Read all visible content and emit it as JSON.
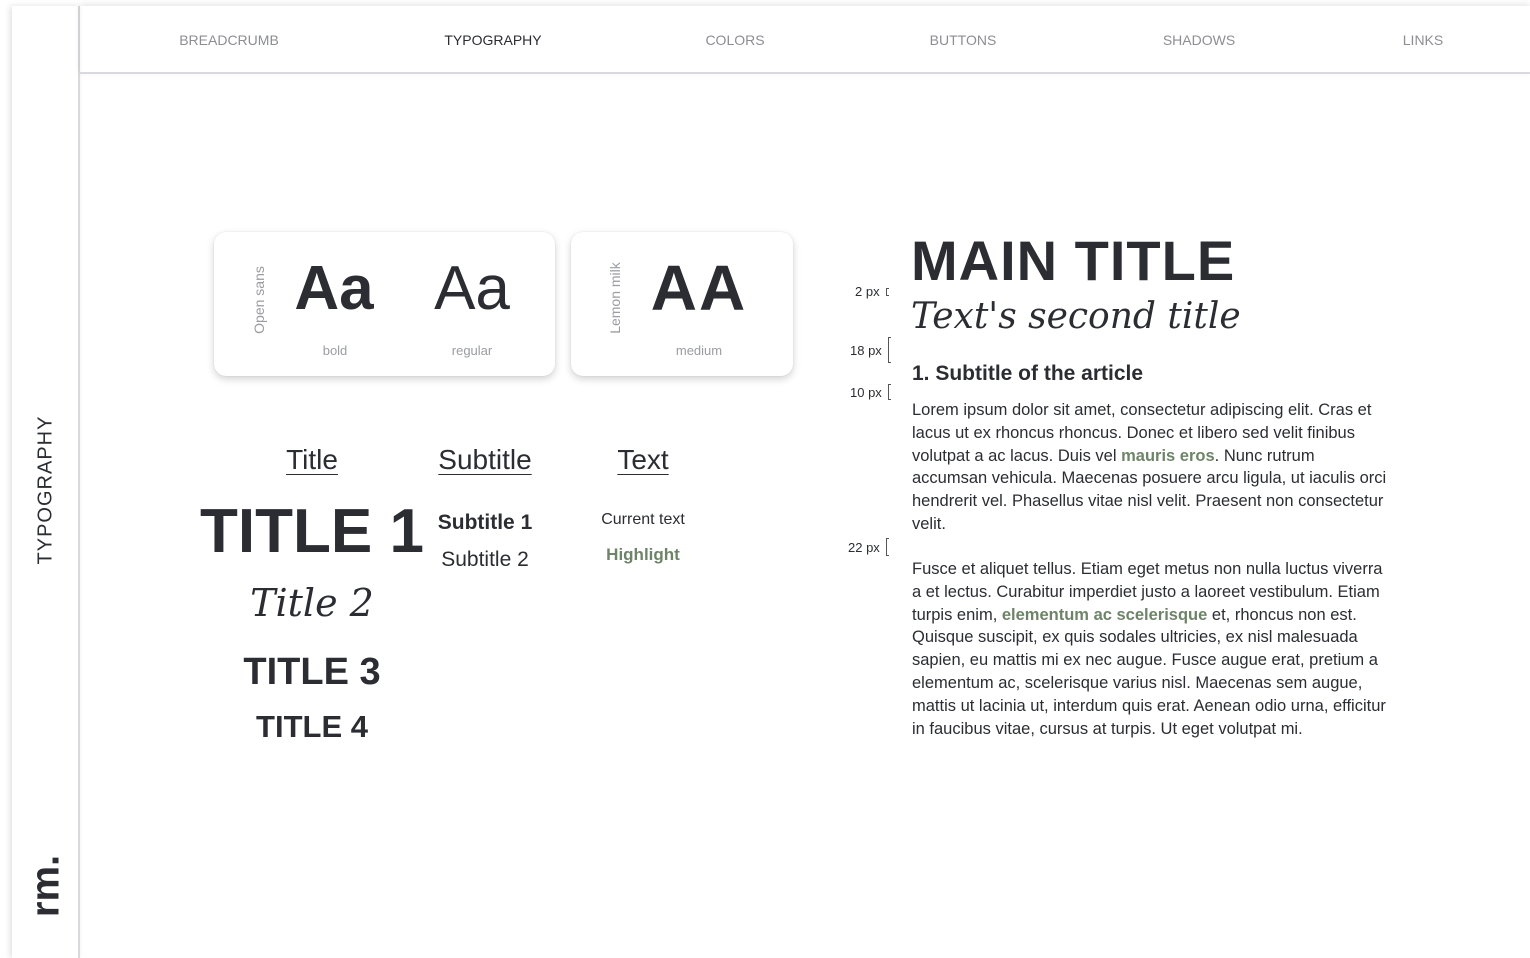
{
  "rail": {
    "label": "TYPOGRAPHY",
    "logo": "rm."
  },
  "nav": {
    "items": [
      {
        "label": "BREADCRUMB"
      },
      {
        "label": "TYPOGRAPHY"
      },
      {
        "label": "COLORS"
      },
      {
        "label": "BUTTONS"
      },
      {
        "label": "SHADOWS"
      },
      {
        "label": "LINKS"
      }
    ],
    "active": "TYPOGRAPHY"
  },
  "fonts": {
    "open_sans": {
      "name": "Open sans",
      "bold_sample": "Aa",
      "bold_label": "bold",
      "regular_sample": "Aa",
      "regular_label": "regular"
    },
    "lemon_milk": {
      "name": "Lemon milk",
      "sample": "AA",
      "label": "medium"
    }
  },
  "columns": {
    "title": {
      "header": "Title",
      "items": [
        "TITLE 1",
        "Title 2",
        "TITLE 3",
        "TITLE 4"
      ]
    },
    "subtitle": {
      "header": "Subtitle",
      "items": [
        "Subtitle 1",
        "Subtitle 2"
      ]
    },
    "text": {
      "header": "Text",
      "items": [
        "Current text",
        "Highlight"
      ]
    }
  },
  "spacings": [
    "2 px",
    "18 px",
    "10 px",
    "22 px"
  ],
  "article": {
    "main_title": "MAIN TITLE",
    "second_title": "Text's second title",
    "subtitle": "1. Subtitle of the article",
    "p1_a": "Lorem ipsum dolor sit amet, consectetur adipiscing elit. Cras et lacus ut ex rhoncus rhoncus. Donec et libero sed velit finibus volutpat a ac lacus. Duis vel ",
    "p1_hl": "mauris eros",
    "p1_b": ". Nunc rutrum accumsan vehicula. Maecenas posuere arcu ligula, ut iaculis orci hendrerit vel. Phasellus vitae nisl velit. Praesent non consectetur velit.",
    "p2_a": "Fusce et aliquet tellus. Etiam eget metus non nulla luctus viverra a et lectus. Curabitur imperdiet justo a laoreet vestibulum. Etiam turpis enim, ",
    "p2_hl": "elementum ac scelerisque",
    "p2_b": " et, rhoncus non est. Quisque suscipit, ex quis sodales ultricies, ex nisl malesuada sapien, eu mattis mi ex nec augue. Fusce augue erat, pretium a elementum ac, scelerisque varius nisl. Maecenas sem augue, mattis ut lacinia ut, interdum quis erat. Aenean odio urna, efficitur in faucibus vitae, cursus at turpis. Ut eget volutpat mi."
  },
  "colors": {
    "text": "#2b2d33",
    "muted": "#8c8e93",
    "highlight": "#6e8468"
  }
}
